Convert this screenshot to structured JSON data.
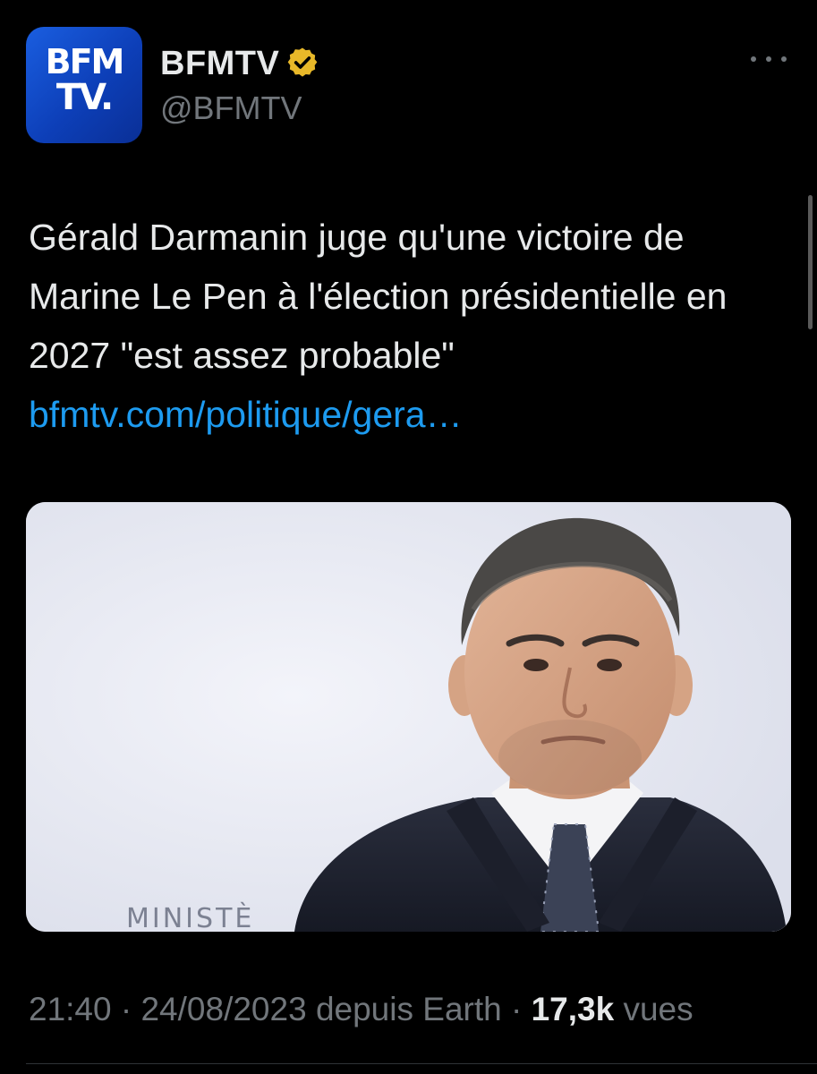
{
  "account": {
    "avatar_logo_line1": "BFM",
    "avatar_logo_line2": "TV.",
    "display_name": "BFMTV",
    "handle": "@BFMTV"
  },
  "tweet": {
    "text": "Gérald Darmanin juge qu'une victoire de Marine Le Pen à l'élection présidentielle en 2027 \"est assez probable\"",
    "link": "bfmtv.com/politique/gera…",
    "media": {
      "sign_text": "MINISTÈ"
    }
  },
  "meta": {
    "time": "21:40",
    "sep1": " · ",
    "date": "24/08/2023",
    "source": " depuis Earth",
    "sep2": " · ",
    "views_count": "17,3k",
    "views_label": " vues"
  },
  "colors": {
    "background": "#000000",
    "text": "#e7e9ea",
    "muted": "#71767b",
    "link": "#1d9bf0",
    "verified_gold": "#e8b829",
    "avatar_blue": "#1a5ee0"
  }
}
